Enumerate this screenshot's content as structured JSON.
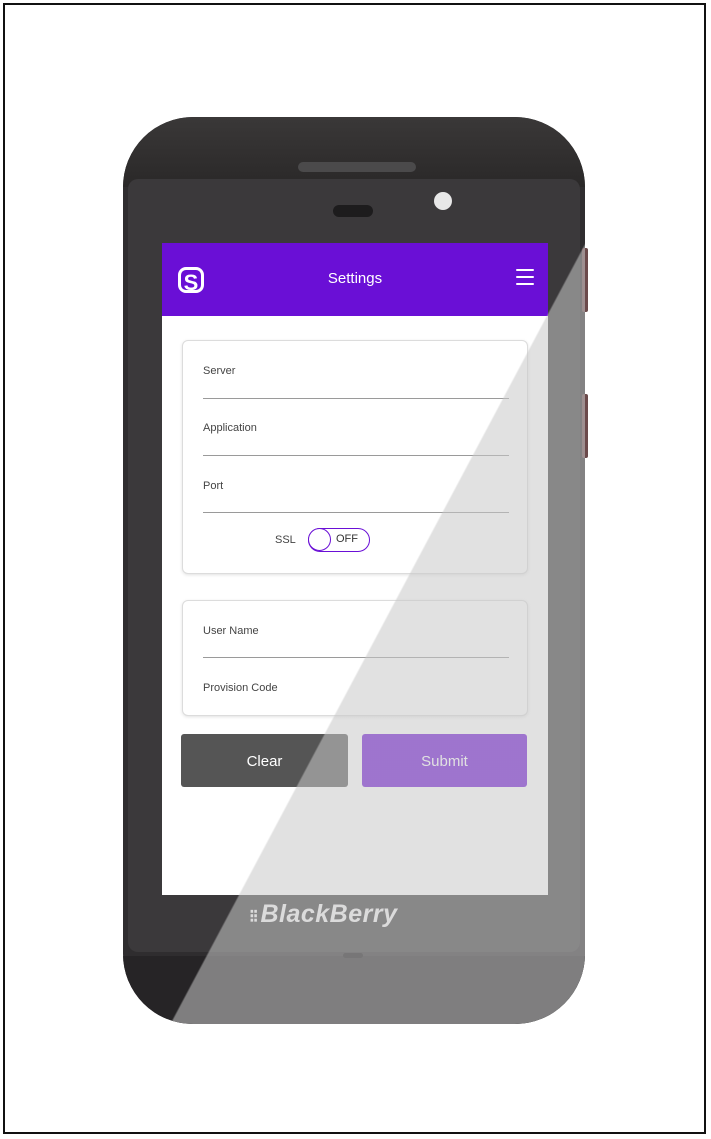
{
  "header": {
    "title": "Settings",
    "logo_glyph": "S",
    "menu_icon": "hamburger-menu-icon"
  },
  "connection": {
    "server_label": "Server",
    "application_label": "Application",
    "port_label": "Port",
    "ssl_label": "SSL",
    "ssl_state": "OFF"
  },
  "credentials": {
    "username_label": "User Name",
    "provision_label": "Provision Code"
  },
  "actions": {
    "clear_label": "Clear",
    "submit_label": "Submit"
  },
  "device": {
    "brand": "BlackBerry"
  },
  "colors": {
    "accent": "#6a0fd6",
    "clear_button": "#555555"
  }
}
